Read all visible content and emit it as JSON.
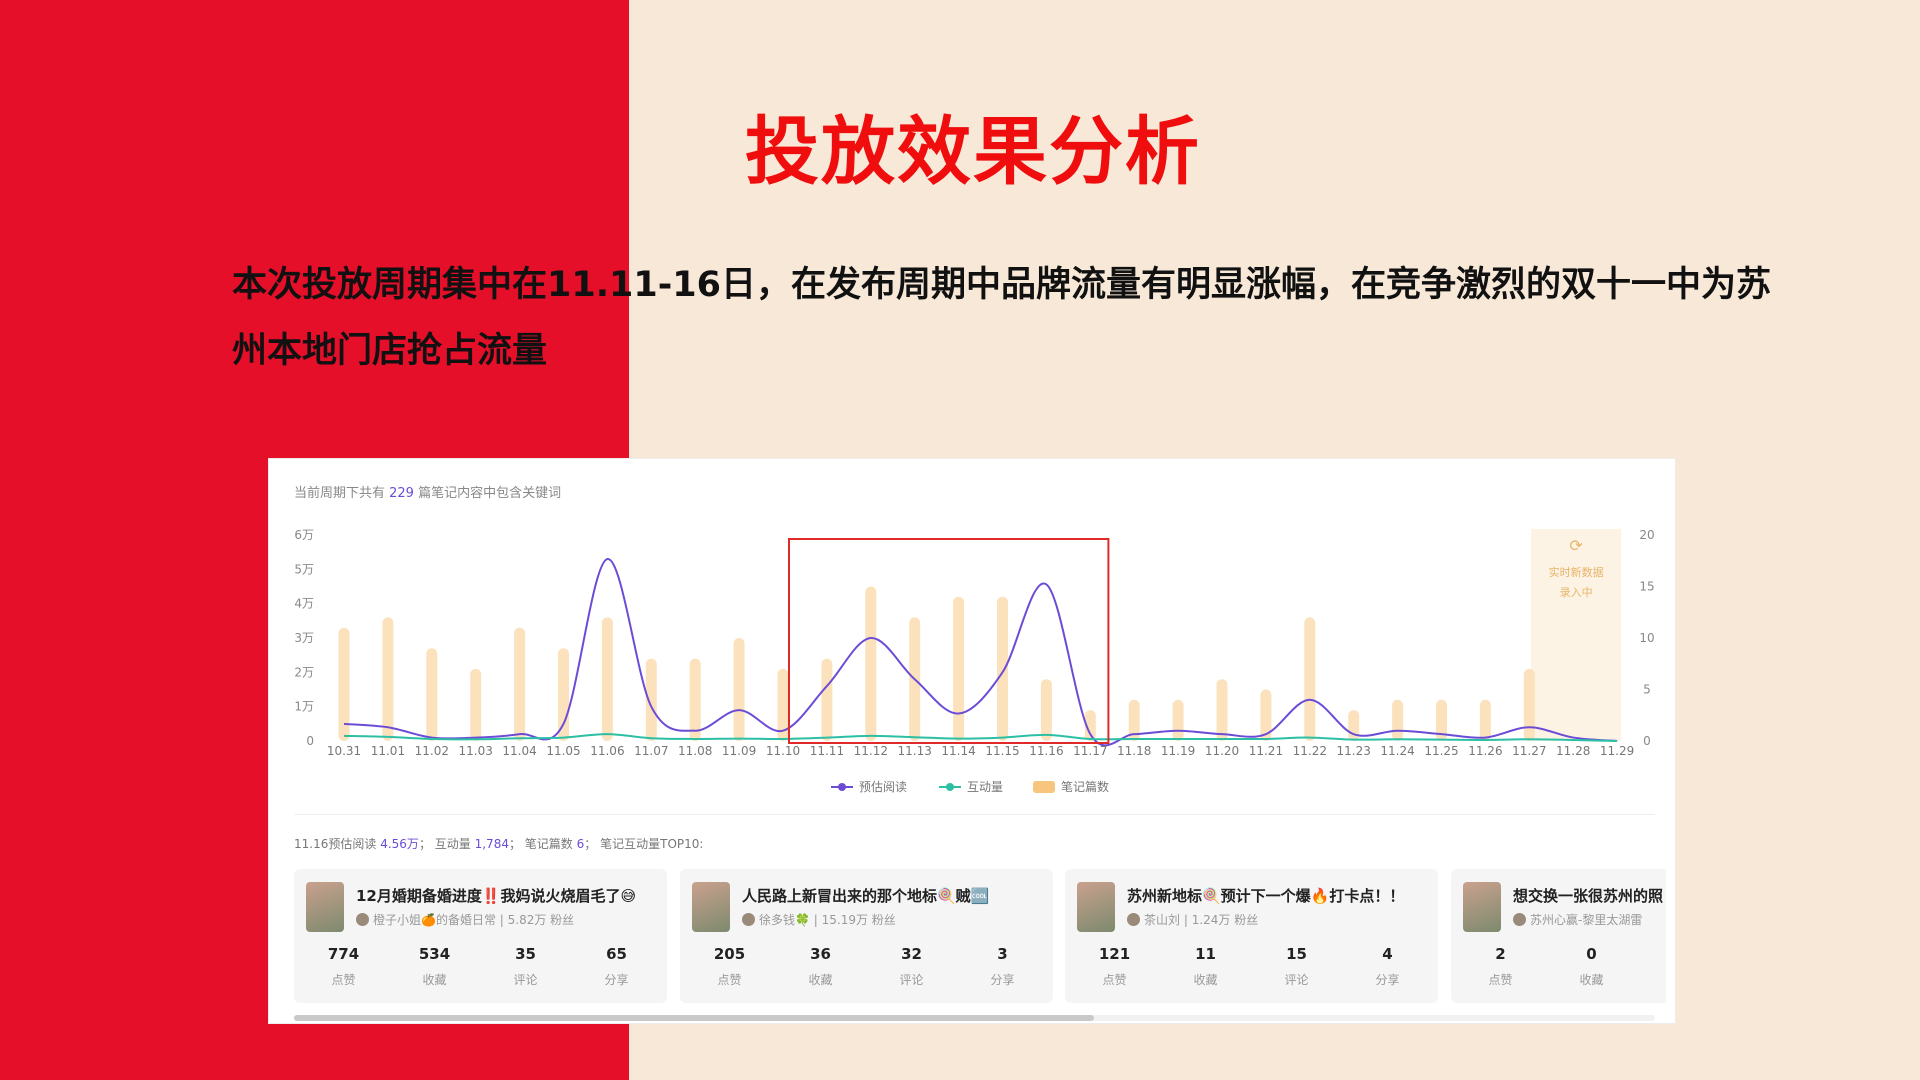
{
  "page": {
    "title": "投放效果分析",
    "intro": "本次投放周期集中在11.11-16日，在发布周期中品牌流量有明显涨幅，在竞争激烈的双十一中为苏州本地门店抢占流量"
  },
  "colors": {
    "left_panel": "#e60f2a",
    "background": "#f7e8d7",
    "read_line": "#6c4cd6",
    "interact_line": "#2cbfa4",
    "note_bar": "#fbe2bd",
    "highlight_box": "#e02a2a"
  },
  "chart_header": {
    "prefix": "当前周期下共有",
    "count": "229",
    "suffix": "篇笔记内容中包含关键词"
  },
  "realtime_badge": {
    "icon": "refresh-icon",
    "line1": "实时新数据",
    "line2": "录入中"
  },
  "chart_data": {
    "type": "line",
    "categories": [
      "10.31",
      "11.01",
      "11.02",
      "11.03",
      "11.04",
      "11.05",
      "11.06",
      "11.07",
      "11.08",
      "11.09",
      "11.10",
      "11.11",
      "11.12",
      "11.13",
      "11.14",
      "11.15",
      "11.16",
      "11.17",
      "11.18",
      "11.19",
      "11.20",
      "11.21",
      "11.22",
      "11.23",
      "11.24",
      "11.25",
      "11.26",
      "11.27",
      "11.28",
      "11.29"
    ],
    "left_axis": {
      "ticks": [
        "0",
        "1万",
        "2万",
        "3万",
        "4万",
        "5万",
        "6万"
      ],
      "range": [
        0,
        60000
      ]
    },
    "right_axis": {
      "ticks": [
        "0",
        "5",
        "10",
        "15",
        "20"
      ],
      "range": [
        0,
        20
      ]
    },
    "series": [
      {
        "name": "预估阅读",
        "axis": "left",
        "kind": "line",
        "values": [
          5000,
          4000,
          1000,
          1000,
          2000,
          5000,
          53000,
          10000,
          3000,
          9000,
          3000,
          16000,
          30000,
          18000,
          8000,
          20000,
          45600,
          2000,
          2000,
          3000,
          2000,
          2000,
          12000,
          2000,
          3000,
          2000,
          1000,
          4000,
          1000,
          0
        ]
      },
      {
        "name": "互动量",
        "axis": "left",
        "kind": "line",
        "values": [
          1500,
          1200,
          600,
          500,
          800,
          1000,
          2000,
          800,
          600,
          700,
          600,
          1000,
          1500,
          1100,
          700,
          1000,
          1784,
          600,
          600,
          600,
          600,
          600,
          1000,
          400,
          500,
          400,
          300,
          500,
          300,
          0
        ]
      },
      {
        "name": "笔记篇数",
        "axis": "right",
        "kind": "bar",
        "values": [
          11,
          12,
          9,
          7,
          11,
          9,
          12,
          8,
          8,
          10,
          7,
          8,
          15,
          12,
          14,
          14,
          6,
          3,
          4,
          4,
          6,
          5,
          12,
          3,
          4,
          4,
          4,
          7,
          0,
          0
        ]
      }
    ],
    "highlight_range": [
      "11.10",
      "11.16"
    ],
    "legend_position": "bottom"
  },
  "summary": {
    "date": "11.16",
    "read_label": "预估阅读",
    "read_value": "4.56万",
    "interact_label": "互动量",
    "interact_value": "1,784",
    "notes_label": "笔记篇数",
    "notes_value": "6",
    "top_label": "笔记互动量TOP10:"
  },
  "cards": [
    {
      "title": "12月婚期备婚进度‼️我妈说火烧眉毛了😅",
      "author": "橙子小姐🍊的备婚日常",
      "fans": "5.82万 粉丝",
      "stats": [
        {
          "n": "774",
          "l": "点赞"
        },
        {
          "n": "534",
          "l": "收藏"
        },
        {
          "n": "35",
          "l": "评论"
        },
        {
          "n": "65",
          "l": "分享"
        }
      ]
    },
    {
      "title": "人民路上新冒出来的那个地标🍭贼🆒",
      "author": "徐多钱🍀",
      "fans": "15.19万 粉丝",
      "stats": [
        {
          "n": "205",
          "l": "点赞"
        },
        {
          "n": "36",
          "l": "收藏"
        },
        {
          "n": "32",
          "l": "评论"
        },
        {
          "n": "3",
          "l": "分享"
        }
      ]
    },
    {
      "title": "苏州新地标🍭预计下一个爆🔥打卡点！！",
      "author": "茶山刘",
      "fans": "1.24万 粉丝",
      "stats": [
        {
          "n": "121",
          "l": "点赞"
        },
        {
          "n": "11",
          "l": "收藏"
        },
        {
          "n": "15",
          "l": "评论"
        },
        {
          "n": "4",
          "l": "分享"
        }
      ]
    },
    {
      "title": "想交换一张很苏州的照",
      "author": "苏州心赢-黎里太湖雷",
      "fans": "",
      "stats": [
        {
          "n": "2",
          "l": "点赞"
        },
        {
          "n": "0",
          "l": "收藏"
        }
      ]
    }
  ]
}
